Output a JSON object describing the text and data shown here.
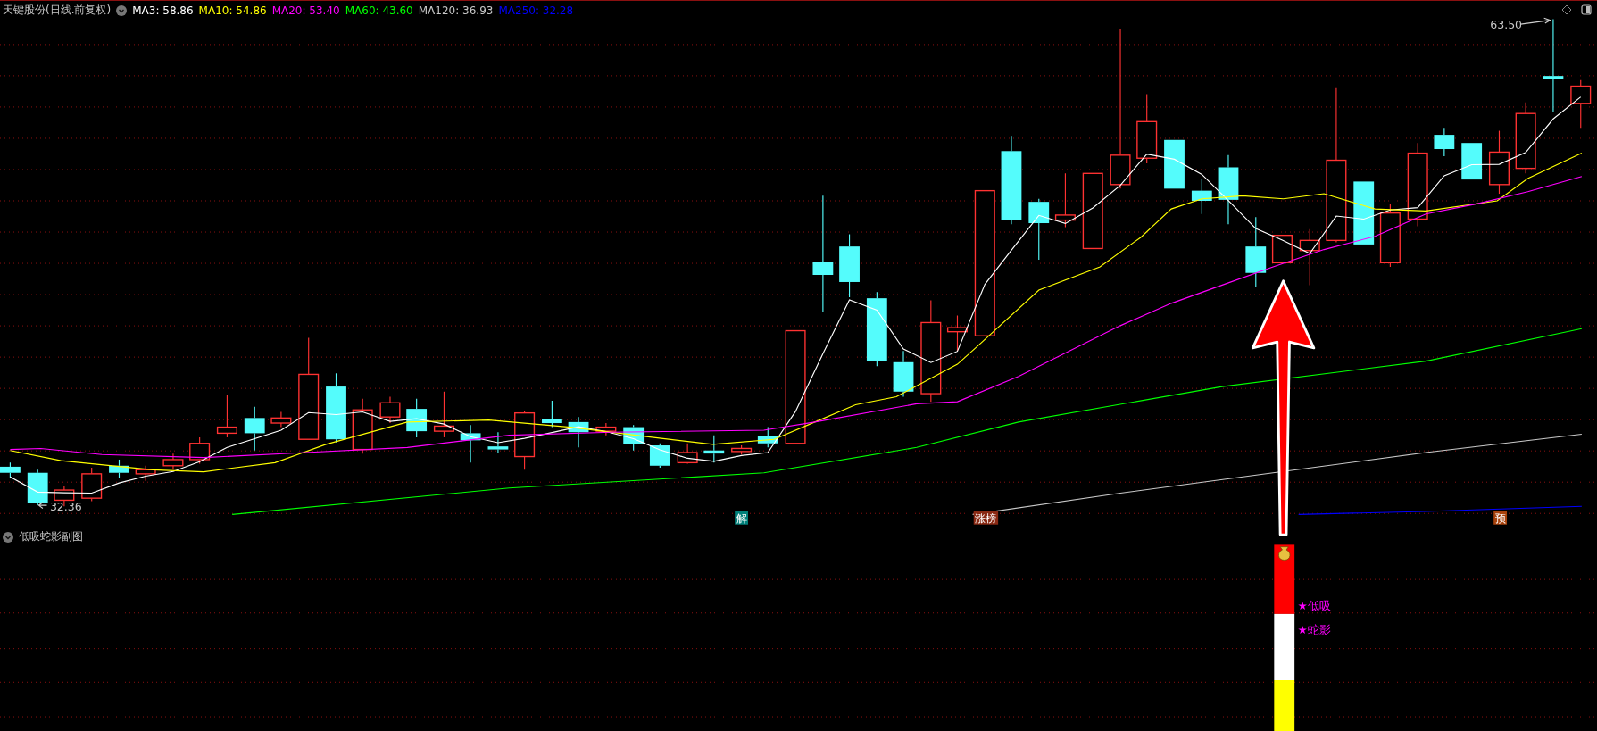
{
  "legend": {
    "title": "天键股份(日线.前复权)",
    "indicators": [
      {
        "label": "MA3: 58.86",
        "color": "#ffffff"
      },
      {
        "label": "MA10: 54.86",
        "color": "#ffff00"
      },
      {
        "label": "MA20: 53.40",
        "color": "#ff00ff"
      },
      {
        "label": "MA60: 43.60",
        "color": "#00ff00"
      },
      {
        "label": "MA120: 36.93",
        "color": "#c8c8c8"
      },
      {
        "label": "MA250: 32.28",
        "color": "#0000ff"
      }
    ]
  },
  "price_labels": [
    {
      "text": "63.50",
      "kind": "high"
    },
    {
      "text": "32.36",
      "kind": "low"
    }
  ],
  "signal_tags": [
    {
      "text": "解",
      "color": "#00807a"
    },
    {
      "text": "涨榜",
      "color": "#8a2a14"
    },
    {
      "text": "预",
      "color": "#a8420c"
    }
  ],
  "subchart": {
    "title": "低吸蛇影副图",
    "signals": [
      {
        "text": "★低吸"
      },
      {
        "text": "★蛇影"
      }
    ]
  }
}
